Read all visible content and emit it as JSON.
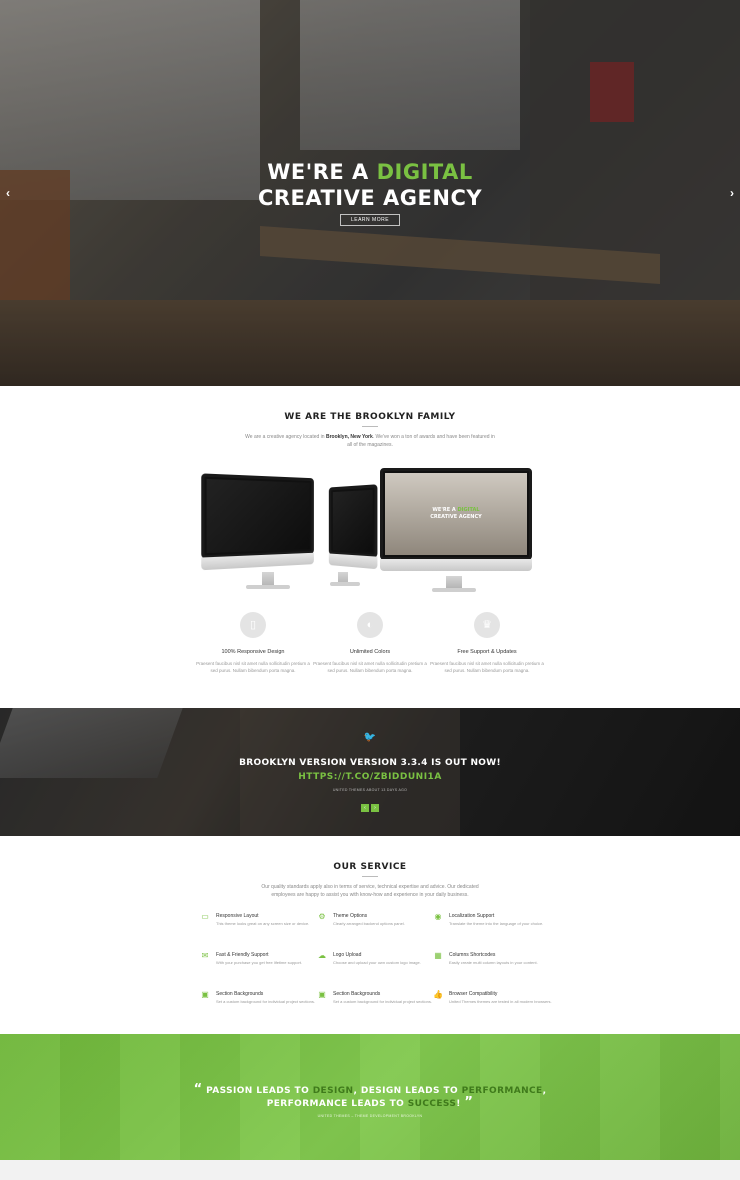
{
  "hero": {
    "title_prefix": "WE'RE A",
    "title_accent": "DIGITAL",
    "title_line2": "CREATIVE AGENCY",
    "button_label": "LEARN MORE",
    "prev_icon": "chevron-left-icon",
    "next_icon": "chevron-right-icon"
  },
  "family": {
    "title": "WE ARE THE BROOKLYN FAMILY",
    "desc_pre": "We are a creative agency located in",
    "desc_bold": "Brooklyn, New York",
    "desc_post": ". We've won a ton of awards and have been featured in all of the magazines.",
    "monitor_text_prefix": "WE'RE A",
    "monitor_text_accent": "DIGITAL",
    "monitor_text_line2": "CREATIVE AGENCY",
    "features": [
      {
        "icon": "tablet-icon",
        "title": "100% Responsive Design",
        "desc": "Praesent faucibus nisl sit amet nulla sollicitudin pretium a sed purus. Nullam bibendum porta magna."
      },
      {
        "icon": "color-drop-icon",
        "title": "Unlimited Colors",
        "desc": "Praesent faucibus nisl sit amet nulla sollicitudin pretium a sed purus. Nullam bibendum porta magna."
      },
      {
        "icon": "trophy-icon",
        "title": "Free Support & Updates",
        "desc": "Praesent faucibus nisl sit amet nulla sollicitudin pretium a sed purus. Nullam bibendum porta magna."
      }
    ]
  },
  "tweet": {
    "icon": "twitter-icon",
    "text": "BROOKLYN VERSION VERSION 3.3.4 IS OUT NOW!",
    "link": "HTTPS://T.CO/ZBIDDUNI1A",
    "meta": "UNITED THEMES ABOUT 13 DAYS AGO",
    "prev": "‹",
    "next": "›"
  },
  "service": {
    "title": "OUR SERVICE",
    "desc": "Our quality standards apply also in terms of service, technical expertise and advice. Our dedicated employees are happy to assist you with know-how and experience in your daily business.",
    "items": [
      {
        "icon": "monitor-icon",
        "title": "Responsive Layout",
        "desc": "This theme looks great on any screen size or device."
      },
      {
        "icon": "gears-icon",
        "title": "Theme Options",
        "desc": "Clearly arranged backend options panel."
      },
      {
        "icon": "globe-icon",
        "title": "Localization Support",
        "desc": "Translate the theme into the language of your choice."
      },
      {
        "icon": "chat-icon",
        "title": "Fast & Friendly Support",
        "desc": "With your purchase you get free lifetime support."
      },
      {
        "icon": "cloud-upload-icon",
        "title": "Logo Upload",
        "desc": "Choose and upload your own custom logo image."
      },
      {
        "icon": "grid-icon",
        "title": "Columns Shortcodes",
        "desc": "Easily create multi column layouts in your content."
      },
      {
        "icon": "image-icon",
        "title": "Section Backgrounds",
        "desc": "Set a custom background for individual project sections."
      },
      {
        "icon": "image-icon",
        "title": "Section Backgrounds",
        "desc": "Set a custom background for individual project sections."
      },
      {
        "icon": "thumbs-up-icon",
        "title": "Browser Compatibility",
        "desc": "United Themes themes are tested in all modern browsers."
      }
    ]
  },
  "quote": {
    "open": "“",
    "close": "”",
    "p1": "PASSION LEADS TO ",
    "h1": "DESIGN",
    "p2": ", DESIGN LEADS TO ",
    "h2": "PERFORMANCE",
    "p3": ",",
    "p4": "PERFORMANCE LEADS TO ",
    "h3": "SUCCESS",
    "p5": "!",
    "meta": "UNITED THEMES – THEME DEVELOPMENT BROOKLYN"
  },
  "colors": {
    "accent": "#7ac142",
    "dark": "#222222"
  }
}
